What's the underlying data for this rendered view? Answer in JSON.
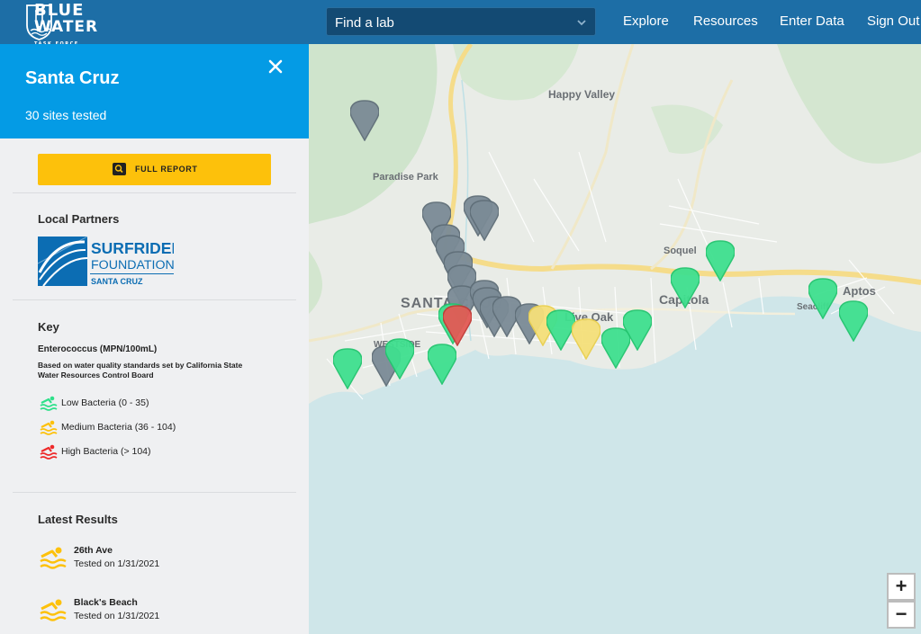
{
  "header": {
    "logo": {
      "line1": "BLUE",
      "line2": "WATER",
      "line3": "TASK FORCE"
    },
    "search": {
      "placeholder": "Find a lab"
    },
    "nav": {
      "explore": "Explore",
      "resources": "Resources",
      "enter_data": "Enter Data",
      "sign_out": "Sign Out"
    }
  },
  "sidebar": {
    "title": "Santa Cruz",
    "subtitle": "30 sites tested",
    "report_button": "FULL REPORT",
    "partners_title": "Local Partners",
    "partner_logo": {
      "line1": "SURFRIDER",
      "line2": "FOUNDATION",
      "line3": "SANTA CRUZ"
    },
    "key": {
      "title": "Key",
      "subtitle": "Enterococcus (MPN/100mL)",
      "description": "Based on water quality standards set by California State Water Resources Control Board",
      "items": [
        {
          "label": "Low Bacteria (0 - 35)",
          "color": "#2ee08a"
        },
        {
          "label": "Medium Bacteria (36 - 104)",
          "color": "#fdc10b"
        },
        {
          "label": "High Bacteria (> 104)",
          "color": "#ee2a2a"
        }
      ]
    },
    "latest": {
      "title": "Latest Results",
      "items": [
        {
          "name": "26th Ave",
          "date": "Tested on 1/31/2021",
          "color": "#fdc10b"
        },
        {
          "name": "Black's Beach",
          "date": "Tested on 1/31/2021",
          "color": "#fdc10b"
        }
      ]
    }
  },
  "map": {
    "labels": {
      "happy_valley": "Happy Valley",
      "paradise_park": "Paradise Park",
      "santa_cruz": "SANTA CRUZ",
      "westside": "WESTSIDE",
      "live_oak": "Live Oak",
      "soquel": "Soquel",
      "capitola": "Capitola",
      "aptos": "Aptos",
      "seacliff": "Seacliff"
    },
    "zoom": {
      "in": "+",
      "out": "−"
    },
    "colors": {
      "low": "#3fe08f",
      "medium": "#f5e07a",
      "high": "#e35a55",
      "untested": "#7b8b96",
      "water": "#cfe6e9",
      "land": "#e9ece7"
    }
  }
}
